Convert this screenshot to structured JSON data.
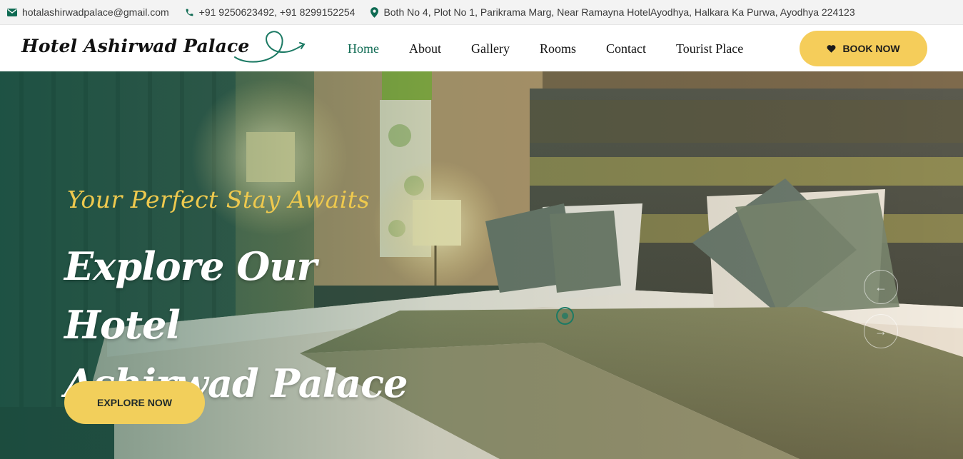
{
  "topbar": {
    "email": "hotalashirwadpalace@gmail.com",
    "phone": "+91 9250623492, +91 8299152254",
    "address": "Both No 4, Plot No 1, Parikrama Marg, Near Ramayna HotelAyodhya, Halkara Ka Purwa, Ayodhya 224123",
    "icons": {
      "email": "envelope-icon",
      "phone": "phone-icon",
      "address": "map-marker-icon"
    }
  },
  "header": {
    "brand": "Hotel Ashirwad Palace",
    "nav": [
      {
        "label": "Home",
        "active": true
      },
      {
        "label": "About"
      },
      {
        "label": "Gallery"
      },
      {
        "label": "Rooms"
      },
      {
        "label": "Contact"
      },
      {
        "label": "Tourist Place"
      }
    ],
    "book_label": "BOOK NOW",
    "book_icon": "heart-icon"
  },
  "hero": {
    "tagline": "Your Perfect Stay Awaits",
    "headline_line1": "Explore Our Hotel",
    "headline_line2": "Ashirwad Palace",
    "cta_label": "EXPLORE NOW",
    "background": "hotel-bedroom-photo",
    "prev_icon": "arrow-left-icon",
    "next_icon": "arrow-right-icon"
  },
  "colors": {
    "accent_yellow": "#f5cd5a",
    "brand_green": "#0f6b53",
    "tagline_yellow": "#eec94e",
    "text_dark": "#111111"
  }
}
